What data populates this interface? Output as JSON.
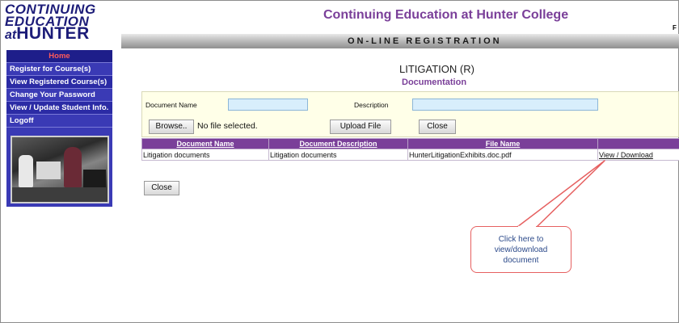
{
  "logo": {
    "line1": "CONTINUING",
    "line2": "EDUCATION",
    "line3_at": "at",
    "line3_hunter": "HUNTER"
  },
  "header": {
    "site_title": "Continuing Education at Hunter College",
    "corner_text": "F",
    "banner": "ON-LINE  REGISTRATION"
  },
  "sidebar": {
    "items": [
      {
        "label": "Home"
      },
      {
        "label": "Register for Course(s)"
      },
      {
        "label": "View Registered Course(s)"
      },
      {
        "label": "Change Your Password"
      },
      {
        "label": "View / Update Student Info."
      },
      {
        "label": "Logoff"
      }
    ]
  },
  "main": {
    "heading": "LITIGATION (R)",
    "subheading": "Documentation",
    "upload": {
      "doc_name_label": "Document Name",
      "doc_name_value": "",
      "description_label": "Description",
      "description_value": "",
      "browse_label": "Browse..",
      "no_file_text": "No file selected.",
      "upload_label": "Upload File",
      "close_label": "Close"
    },
    "table": {
      "headers": [
        "Document Name",
        "Document Description",
        "File Name",
        ""
      ],
      "rows": [
        [
          "Litigation documents",
          "Litigation documents",
          "HunterLitigationExhibits.doc.pdf",
          "View / Download"
        ]
      ]
    },
    "close_bottom_label": "Close"
  },
  "callout": {
    "line1": "Click here to",
    "line2": "view/download",
    "line3": "document"
  },
  "colors": {
    "accent_purple": "#7a3f99",
    "sidebar_blue": "#3a3ab5",
    "home_red": "#ff5a5a",
    "callout_border": "#e66060",
    "callout_text": "#2c4a8a"
  }
}
